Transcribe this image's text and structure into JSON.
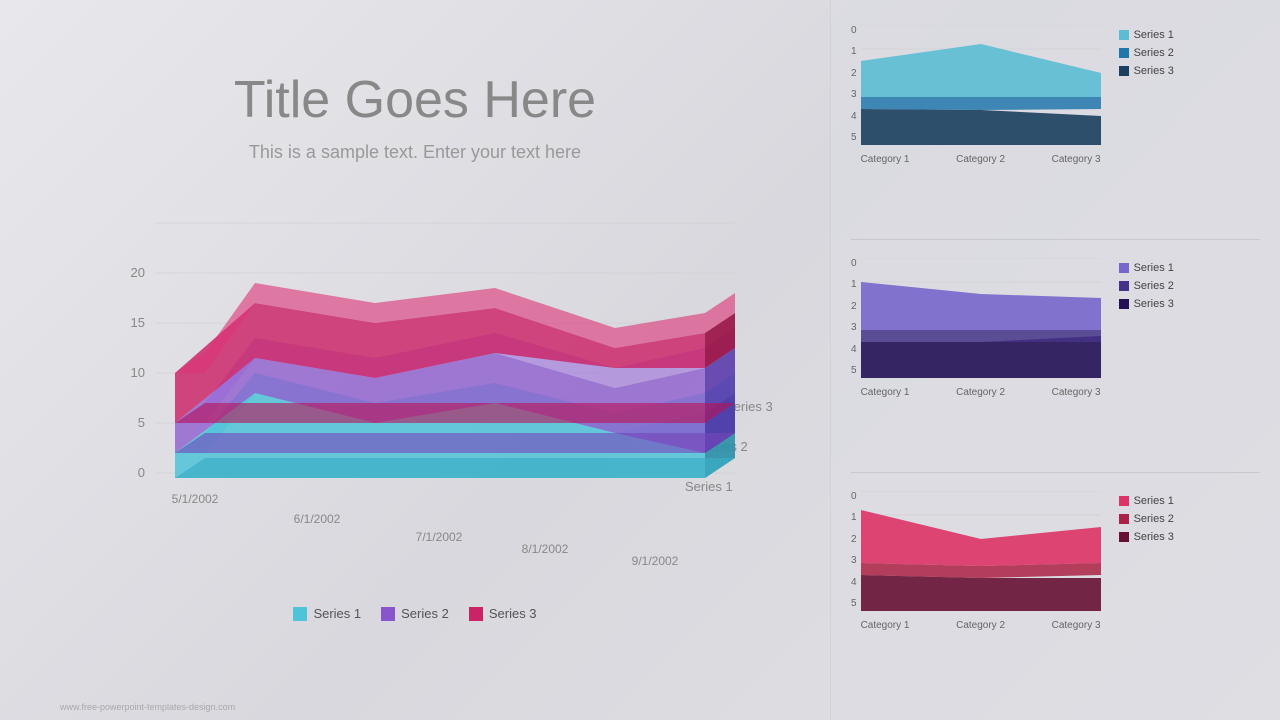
{
  "title": "Title Goes Here",
  "subtitle": "This is a sample text. Enter your text here",
  "watermark": "www.free-powerpoint-templates-design.com",
  "mainChart": {
    "xLabels": [
      "5/1/2002",
      "6/1/2002",
      "7/1/2002",
      "8/1/2002",
      "9/1/2002"
    ],
    "yLabels": [
      "0",
      "5",
      "10",
      "15",
      "20"
    ],
    "series": [
      "Series 1",
      "Series 2",
      "Series 3"
    ],
    "colors": [
      "#4fc3d8",
      "#8855cc",
      "#cc2266"
    ]
  },
  "smallCharts": [
    {
      "type": "teal",
      "yLabels": [
        "0",
        "1",
        "2",
        "3",
        "4",
        "5"
      ],
      "xLabels": [
        "Category 1",
        "Category 2",
        "Category 3"
      ],
      "series": [
        "Series 1",
        "Series 2",
        "Series 3"
      ],
      "colors": [
        "#5bbcd4",
        "#2277aa",
        "#1a3f5f"
      ],
      "data": {
        "s1": [
          3.5,
          4.2,
          3.0
        ],
        "s2": [
          2.0,
          2.5,
          2.0
        ],
        "s3": [
          1.5,
          1.8,
          1.2
        ]
      }
    },
    {
      "type": "purple",
      "yLabels": [
        "0",
        "1",
        "2",
        "3",
        "4",
        "5"
      ],
      "xLabels": [
        "Category 1",
        "Category 2",
        "Category 3"
      ],
      "series": [
        "Series 1",
        "Series 2",
        "Series 3"
      ],
      "colors": [
        "#7766cc",
        "#443388",
        "#221155"
      ],
      "data": {
        "s1": [
          4.0,
          3.5,
          3.2
        ],
        "s2": [
          2.5,
          2.0,
          2.5
        ],
        "s3": [
          1.5,
          1.5,
          1.8
        ]
      }
    },
    {
      "type": "pink",
      "yLabels": [
        "0",
        "1",
        "2",
        "3",
        "4",
        "5"
      ],
      "xLabels": [
        "Category 1",
        "Category 2",
        "Category 3"
      ],
      "series": [
        "Series 1",
        "Series 2",
        "Series 3"
      ],
      "colors": [
        "#dd3366",
        "#aa2244",
        "#661133"
      ],
      "data": {
        "s1": [
          4.2,
          3.0,
          3.5
        ],
        "s2": [
          2.5,
          2.2,
          2.8
        ],
        "s3": [
          1.8,
          1.5,
          1.5
        ]
      }
    }
  ]
}
